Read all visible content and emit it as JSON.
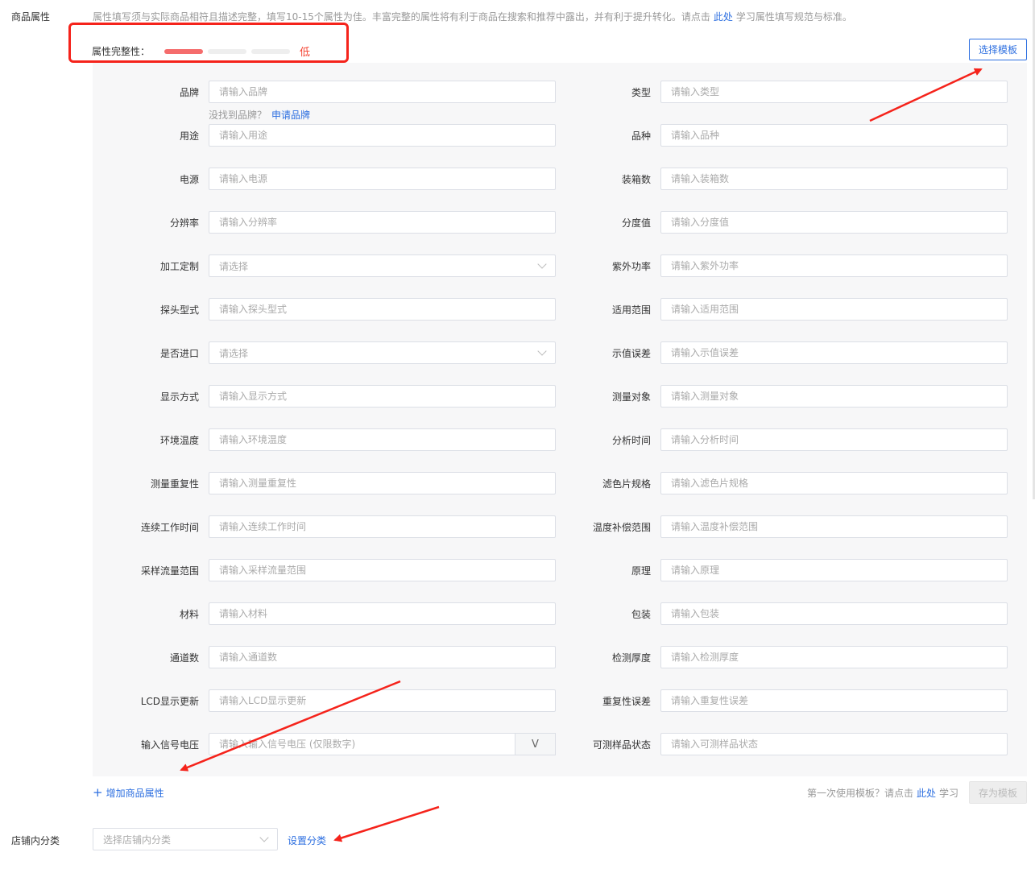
{
  "product_attributes": {
    "section_label": "商品属性",
    "hint_before": "属性填写须与实际商品相符且描述完整，填写10-15个属性为佳。丰富完整的属性将有利于商品在搜索和推荐中露出，并有利于提升转化。请点击",
    "hint_link": "此处",
    "hint_after": "学习属性填写规范与标准。",
    "completeness_label": "属性完整性：",
    "completeness_level": "低",
    "completeness_progress": {
      "filled_segments": 1,
      "total_segments": 3
    },
    "select_template_button": "选择模板",
    "brand_tip_text": "没找到品牌？",
    "brand_tip_link": "申请品牌",
    "fields_left": [
      {
        "label": "品牌",
        "placeholder": "请输入品牌",
        "kind": "input"
      },
      {
        "label": "用途",
        "placeholder": "请输入用途",
        "kind": "input"
      },
      {
        "label": "电源",
        "placeholder": "请输入电源",
        "kind": "input"
      },
      {
        "label": "分辨率",
        "placeholder": "请输入分辨率",
        "kind": "input"
      },
      {
        "label": "加工定制",
        "placeholder": "请选择",
        "kind": "select"
      },
      {
        "label": "探头型式",
        "placeholder": "请输入探头型式",
        "kind": "input"
      },
      {
        "label": "是否进口",
        "placeholder": "请选择",
        "kind": "select"
      },
      {
        "label": "显示方式",
        "placeholder": "请输入显示方式",
        "kind": "input"
      },
      {
        "label": "环境温度",
        "placeholder": "请输入环境温度",
        "kind": "input"
      },
      {
        "label": "测量重复性",
        "placeholder": "请输入测量重复性",
        "kind": "input"
      },
      {
        "label": "连续工作时间",
        "placeholder": "请输入连续工作时间",
        "kind": "input"
      },
      {
        "label": "采样流量范围",
        "placeholder": "请输入采样流量范围",
        "kind": "input"
      },
      {
        "label": "材料",
        "placeholder": "请输入材料",
        "kind": "input"
      },
      {
        "label": "通道数",
        "placeholder": "请输入通道数",
        "kind": "input"
      },
      {
        "label": "LCD显示更新",
        "placeholder": "请输入LCD显示更新",
        "kind": "input"
      },
      {
        "label": "输入信号电压",
        "placeholder": "请输入输入信号电压 (仅限数字)",
        "kind": "unit",
        "unit": "V"
      }
    ],
    "fields_right": [
      {
        "label": "类型",
        "placeholder": "请输入类型"
      },
      {
        "label": "品种",
        "placeholder": "请输入品种"
      },
      {
        "label": "装箱数",
        "placeholder": "请输入装箱数"
      },
      {
        "label": "分度值",
        "placeholder": "请输入分度值"
      },
      {
        "label": "紫外功率",
        "placeholder": "请输入紫外功率"
      },
      {
        "label": "适用范围",
        "placeholder": "请输入适用范围"
      },
      {
        "label": "示值误差",
        "placeholder": "请输入示值误差"
      },
      {
        "label": "测量对象",
        "placeholder": "请输入测量对象"
      },
      {
        "label": "分析时间",
        "placeholder": "请输入分析时间"
      },
      {
        "label": "滤色片规格",
        "placeholder": "请输入滤色片规格"
      },
      {
        "label": "温度补偿范围",
        "placeholder": "请输入温度补偿范围"
      },
      {
        "label": "原理",
        "placeholder": "请输入原理"
      },
      {
        "label": "包装",
        "placeholder": "请输入包装"
      },
      {
        "label": "检测厚度",
        "placeholder": "请输入检测厚度"
      },
      {
        "label": "重复性误差",
        "placeholder": "请输入重复性误差"
      },
      {
        "label": "可测样品状态",
        "placeholder": "请输入可测样品状态"
      }
    ],
    "add_attribute_link": "增加商品属性",
    "first_use_text": "第一次使用模板？请点击",
    "first_use_link": "此处",
    "first_use_after": "学习",
    "save_template_button": "存为模板"
  },
  "shop_category": {
    "section_label": "店铺内分类",
    "select_placeholder": "选择店铺内分类",
    "set_category_link": "设置分类"
  },
  "colors": {
    "accent": "#2d6fe0",
    "warning": "#f5412f",
    "annotation": "#f5231b"
  }
}
